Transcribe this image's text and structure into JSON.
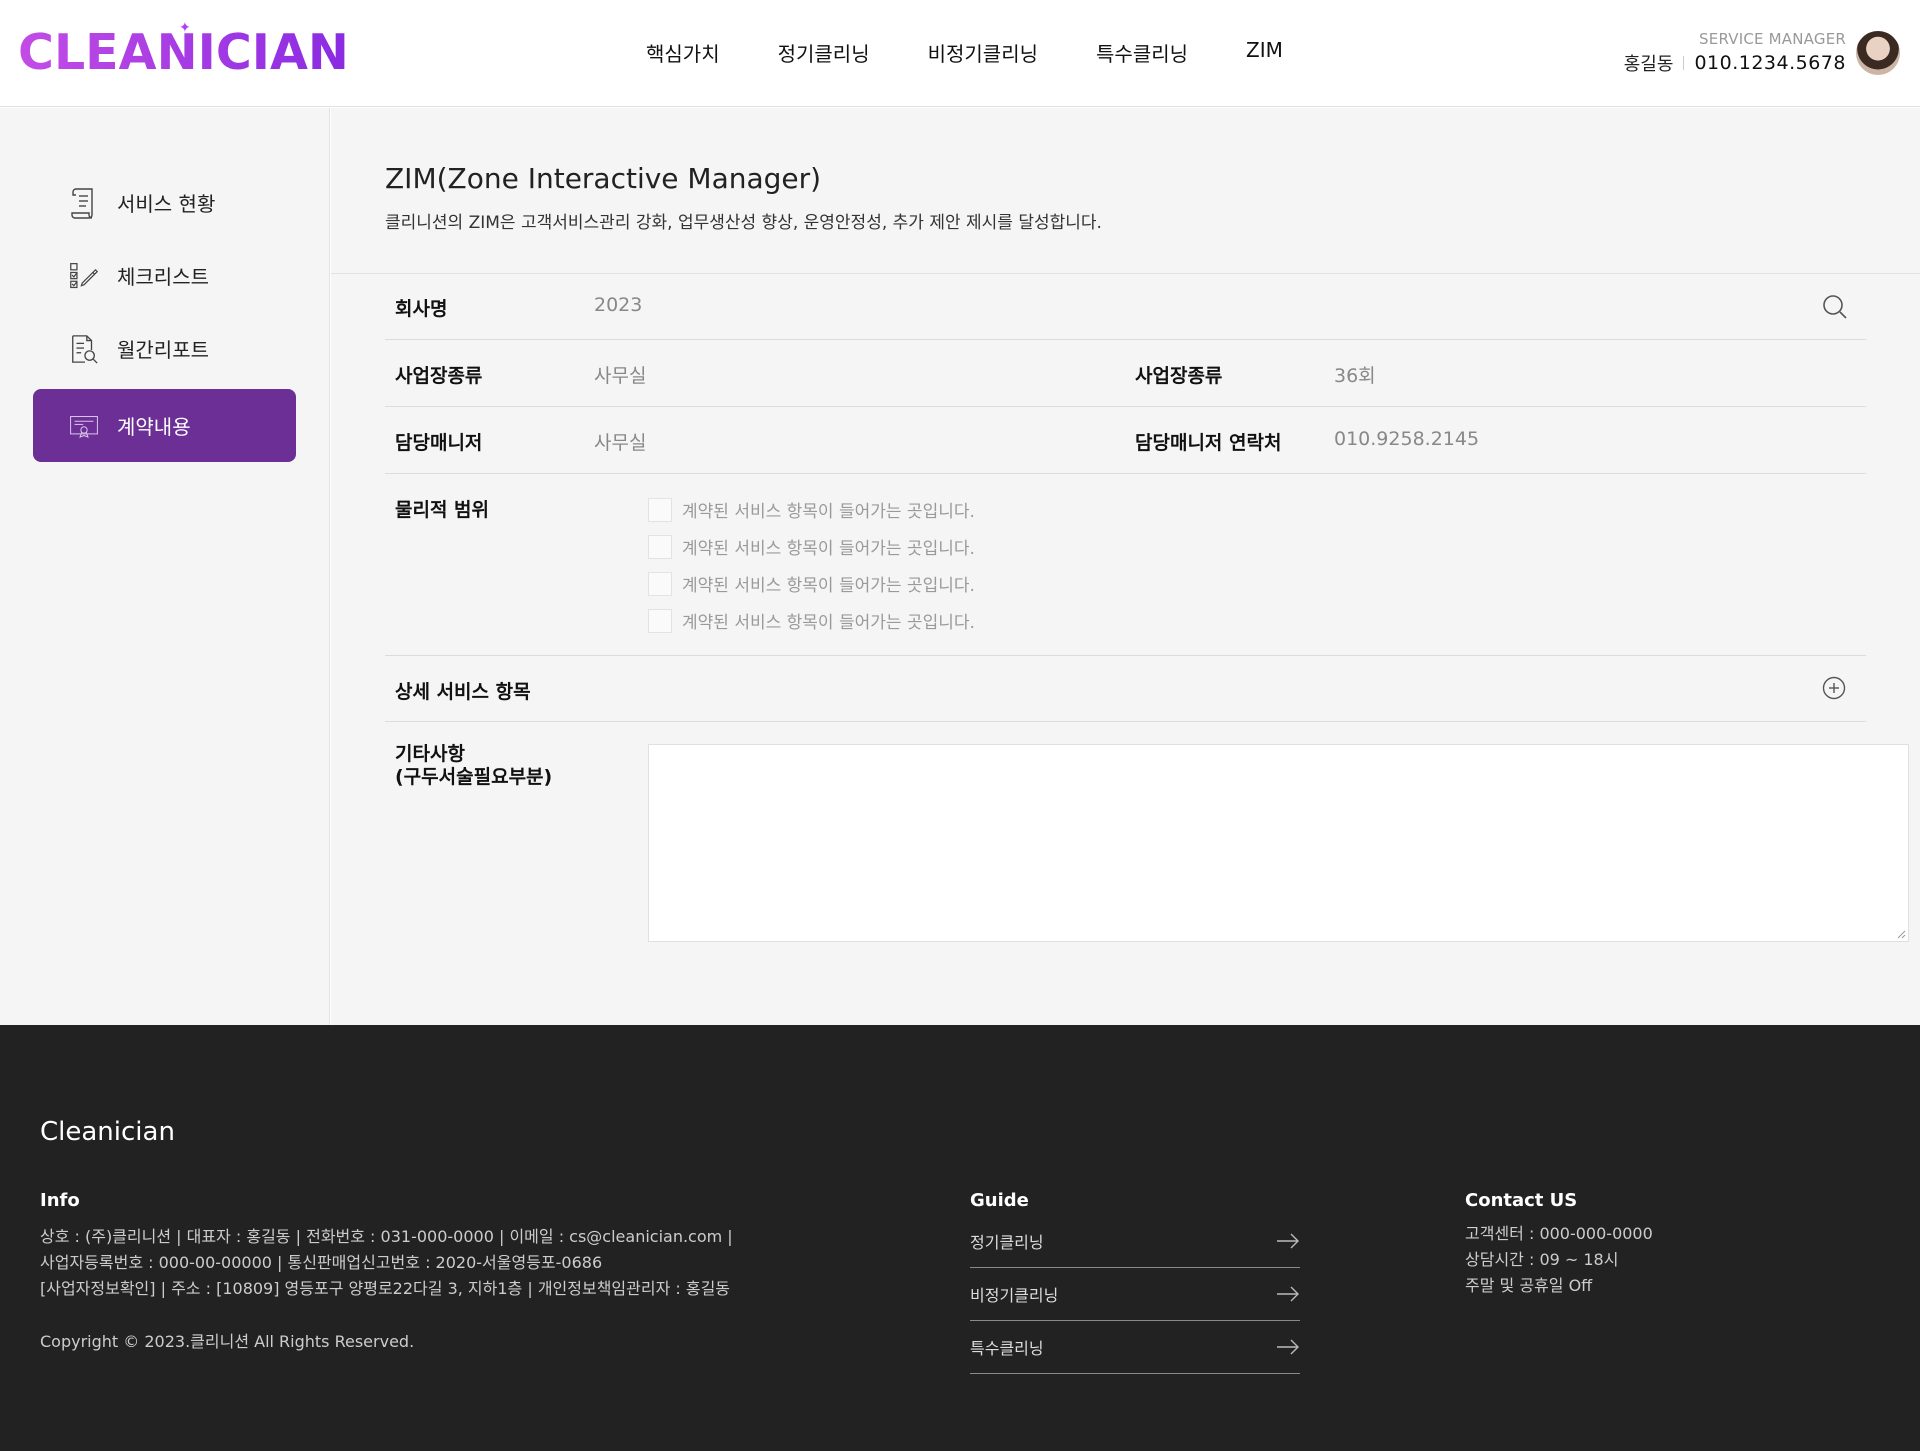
{
  "header": {
    "logo": "CLEANICIAN",
    "nav": [
      "핵심가치",
      "정기클리닝",
      "비정기클리닝",
      "특수클리닝",
      "ZIM"
    ],
    "manager_role": "SERVICE MANAGER",
    "manager_name": "홍길동",
    "manager_phone": "010.1234.5678"
  },
  "sidebar": {
    "items": [
      {
        "label": "서비스 현황",
        "icon": "document-list-icon"
      },
      {
        "label": "체크리스트",
        "icon": "checklist-pen-icon"
      },
      {
        "label": "월간리포트",
        "icon": "report-search-icon"
      },
      {
        "label": "계약내용",
        "icon": "contract-certificate-icon",
        "active": true
      }
    ]
  },
  "main": {
    "title": "ZIM(Zone Interactive Manager)",
    "description": "클리니션의 ZIM은 고객서비스관리 강화, 업무생산성 향상, 운영안정성, 추가 제안 제시를 달성합니다.",
    "company": {
      "label": "회사명",
      "value": "2023"
    },
    "row2": {
      "label_left": "사업장종류",
      "value_left": "사무실",
      "label_right": "사업장종류",
      "value_right": "36회"
    },
    "row3": {
      "label_left": "담당매니저",
      "value_left": "사무실",
      "label_right": "담당매니저 연락처",
      "value_right": "010.9258.2145"
    },
    "physical": {
      "label": "물리적 범위",
      "items": [
        "계약된 서비스 항목이 들어가는 곳입니다.",
        "계약된 서비스 항목이 들어가는 곳입니다.",
        "계약된 서비스 항목이 들어가는 곳입니다.",
        "계약된 서비스 항목이 들어가는 곳입니다."
      ]
    },
    "detail": {
      "label": "상세 서비스 항목"
    },
    "etc": {
      "label_line1": "기타사항",
      "label_line2": "(구두서술필요부분)"
    }
  },
  "footer": {
    "brand": "Cleanician",
    "info_title": "Info",
    "info_lines": [
      "상호 : (주)클리니션 | 대표자 : 홍길동 | 전화번호 : 031-000-0000 | 이메일 : cs@cleanician.com |",
      "사업자등록번호 : 000-00-00000 | 통신판매업신고번호 : 2020-서울영등포-0686",
      "[사업자정보확인] | 주소 : [10809] 영등포구 양평로22다길 3, 지하1층 | 개인정보책임관리자 : 홍길동"
    ],
    "copyright": "Copyright © 2023.클리니션 All Rights Reserved.",
    "guide_title": "Guide",
    "guide_links": [
      "정기클리닝",
      "비정기클리닝",
      "특수클리닝"
    ],
    "contact_title": "Contact US",
    "contact_lines": [
      "고객센터 : 000-000-0000",
      "상담시간 : 09 ~ 18시",
      "주말 및 공휴일 Off"
    ]
  },
  "colors": {
    "brand_purple": "#6b2f96",
    "logo_gradient_start": "#c34ce6",
    "logo_gradient_end": "#8a2be2",
    "footer_bg": "#222222",
    "page_bg": "#f5f5f5"
  }
}
